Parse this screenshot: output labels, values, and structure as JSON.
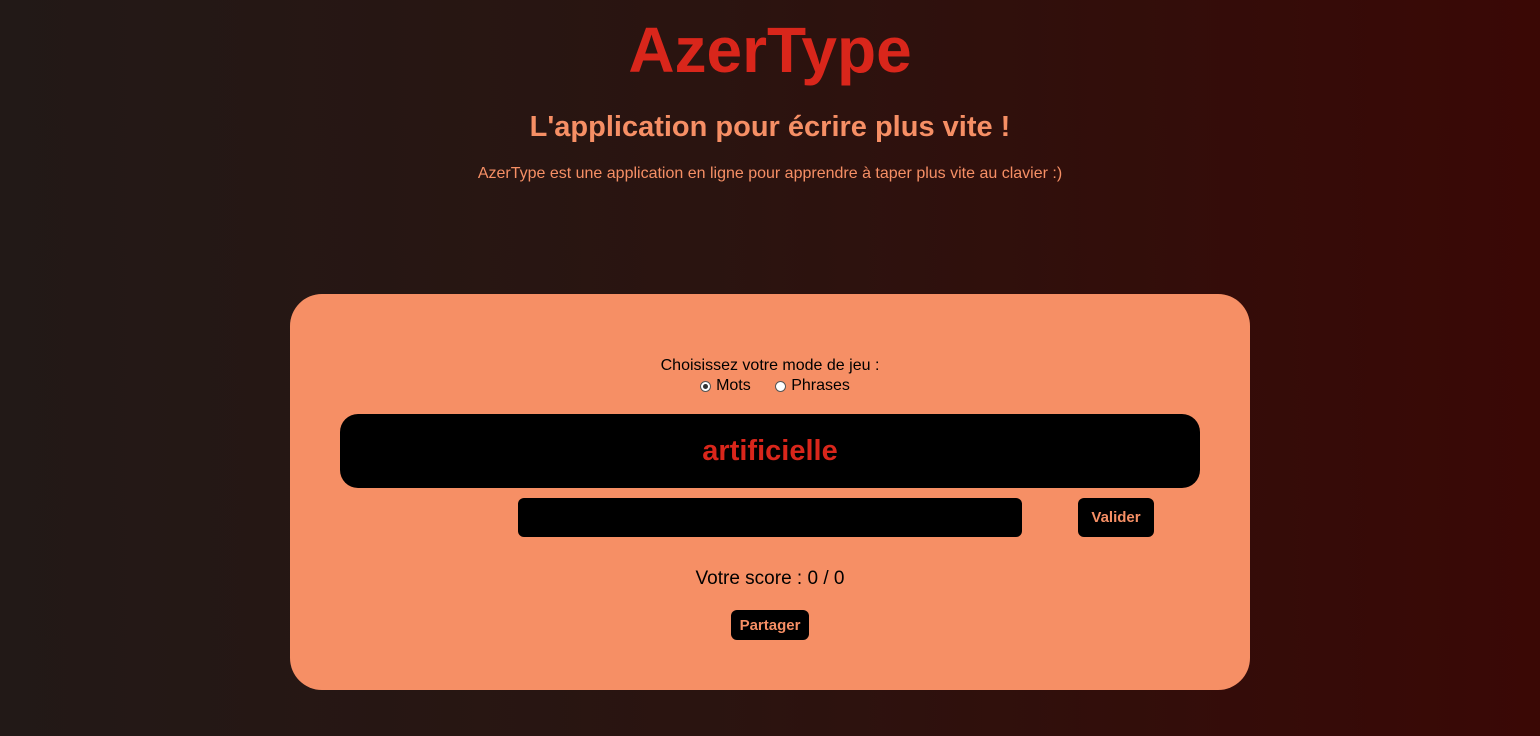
{
  "header": {
    "title": "AzerType",
    "subtitle": "L'application pour écrire plus vite !",
    "description": "AzerType est une application en ligne pour apprendre à taper plus vite au clavier :)"
  },
  "game": {
    "mode_label": "Choisissez votre mode de jeu :",
    "modes": [
      {
        "label": "Mots",
        "selected": true
      },
      {
        "label": "Phrases",
        "selected": false
      }
    ],
    "word": "artificielle",
    "input": {
      "value": "",
      "placeholder": ""
    },
    "validate_label": "Valider",
    "score_text": "Votre score : 0 / 0",
    "share_label": "Partager"
  },
  "colors": {
    "accent_red": "#d9261b",
    "salmon": "#f68f65",
    "black": "#000000"
  }
}
